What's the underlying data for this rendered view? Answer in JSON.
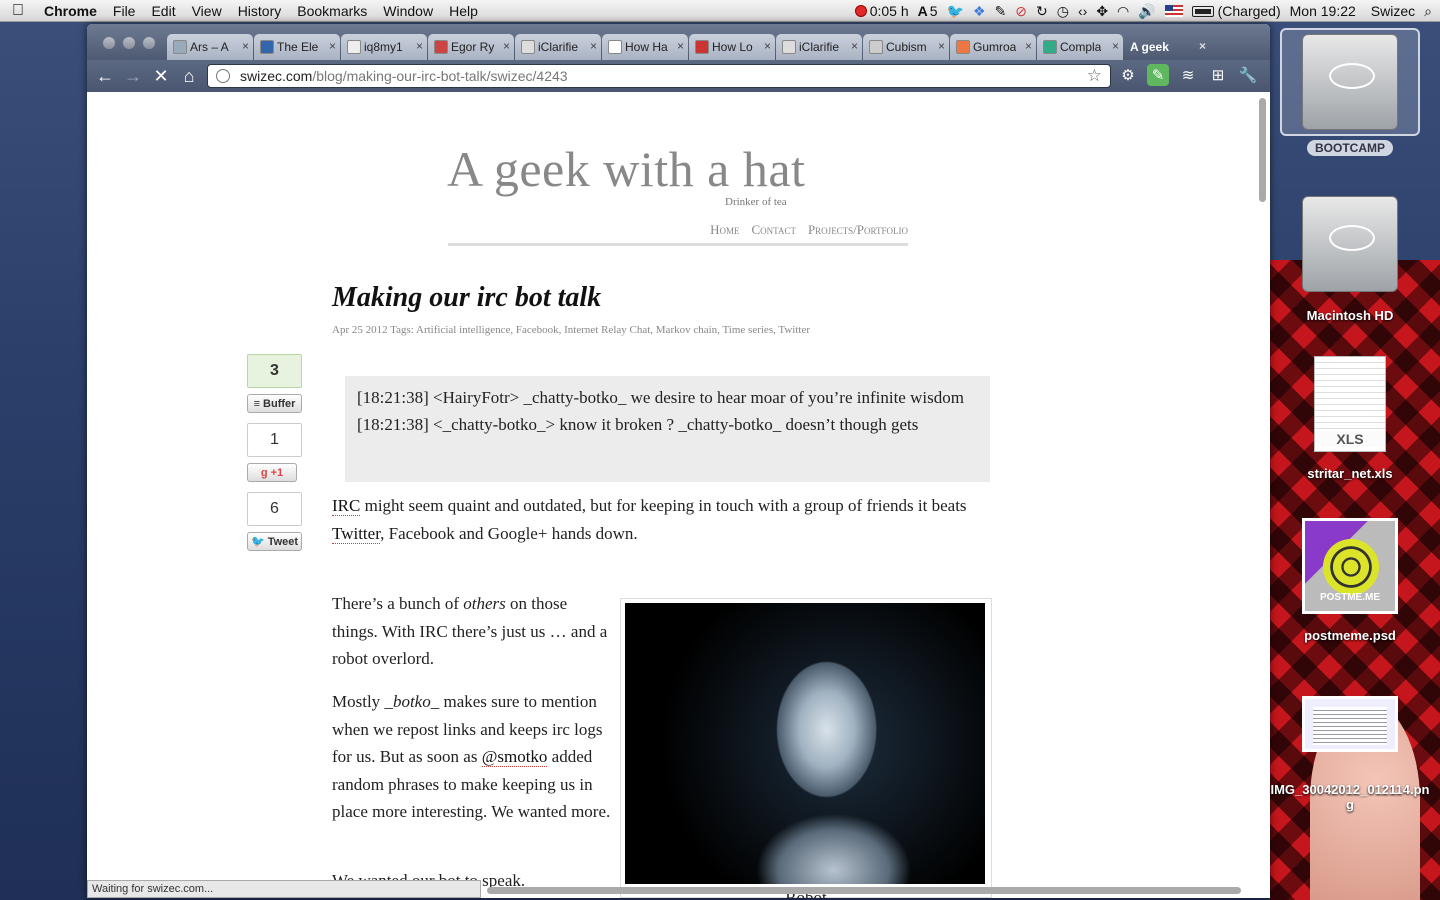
{
  "menubar": {
    "apple": "",
    "app": "Chrome",
    "menus": [
      "File",
      "Edit",
      "View",
      "History",
      "Bookmarks",
      "Window",
      "Help"
    ],
    "timer": "0:05 h",
    "adobe_count": "5",
    "battery": "(Charged)",
    "clock": "Mon 19:22",
    "user": "Swizec"
  },
  "browser": {
    "tabs": [
      {
        "label": "Ars – A",
        "fav": "#9ab"
      },
      {
        "label": "The Ele",
        "fav": "#36a"
      },
      {
        "label": "iq8my1",
        "fav": "#eee"
      },
      {
        "label": "Egor Ry",
        "fav": "#c44"
      },
      {
        "label": "iClarifie",
        "fav": "#ddd"
      },
      {
        "label": "How Ha",
        "fav": "#fff"
      },
      {
        "label": "How Lo",
        "fav": "#c33"
      },
      {
        "label": "iClarifie",
        "fav": "#ddd"
      },
      {
        "label": "Cubism",
        "fav": "#ccc"
      },
      {
        "label": "Gumroa",
        "fav": "#e74"
      },
      {
        "label": "Compla",
        "fav": "#3a8"
      },
      {
        "label": "A geek",
        "fav": "none",
        "active": true
      }
    ],
    "url_host": "swizec.com",
    "url_path": "/blog/making-our-irc-bot-talk/swizec/4243",
    "status": "Waiting for swizec.com..."
  },
  "site": {
    "title": "A geek with a hat",
    "tagline": "Drinker of tea",
    "nav": [
      "Home",
      "Contact",
      "Projects/Portfolio"
    ]
  },
  "post": {
    "title": "Making our irc bot talk",
    "date": "Apr 25 2012",
    "tags_label": "Tags:",
    "tags": "Artificial intelligence, Facebook, Internet Relay Chat, Markov chain, Time series, Twitter",
    "irc_line1": "[18:21:38] <HairyFotr> _chatty-botko_ we desire to hear moar of you’re infinite wisdom",
    "irc_line2": "[18:21:38] <_chatty-botko_> know it broken ? _chatty-botko_ doesn’t though gets",
    "p1_link1": "IRC",
    "p1_a": " might seem quaint and outdated, but for keeping in touch with a group of friends it beats ",
    "p1_link2": "Twitter",
    "p1_b": ", Facebook and Google+ hands down.",
    "p2_a": "There’s a bunch of ",
    "p2_em": "others",
    "p2_b": " on those things. With IRC there’s just us … and a robot overlord.",
    "p3_a": "Mostly ",
    "p3_em": "_botko_",
    "p3_b": " makes sure to mention when we repost links and keeps irc logs for us. But as soon as ",
    "p3_link": "@smotko",
    "p3_c": " added random phrases to make keeping us in place more interesting. We wanted more.",
    "p4": "We wanted our bot to speak.",
    "figure_caption": "Robot"
  },
  "share": {
    "buffer_count": "3",
    "buffer_label": "Buffer",
    "gplus_count": "1",
    "gplus_label": "+1",
    "tweet_count": "6",
    "tweet_label": "Tweet"
  },
  "desktop": {
    "icons": [
      {
        "label": "BOOTCAMP"
      },
      {
        "label": "Macintosh HD"
      },
      {
        "label": "stritar_net.xls",
        "ext": "XLS"
      },
      {
        "label": "postmeme.psd",
        "thumb_text": "POSTME.ME"
      },
      {
        "label": "IMG_30042012_012114.png"
      }
    ]
  }
}
